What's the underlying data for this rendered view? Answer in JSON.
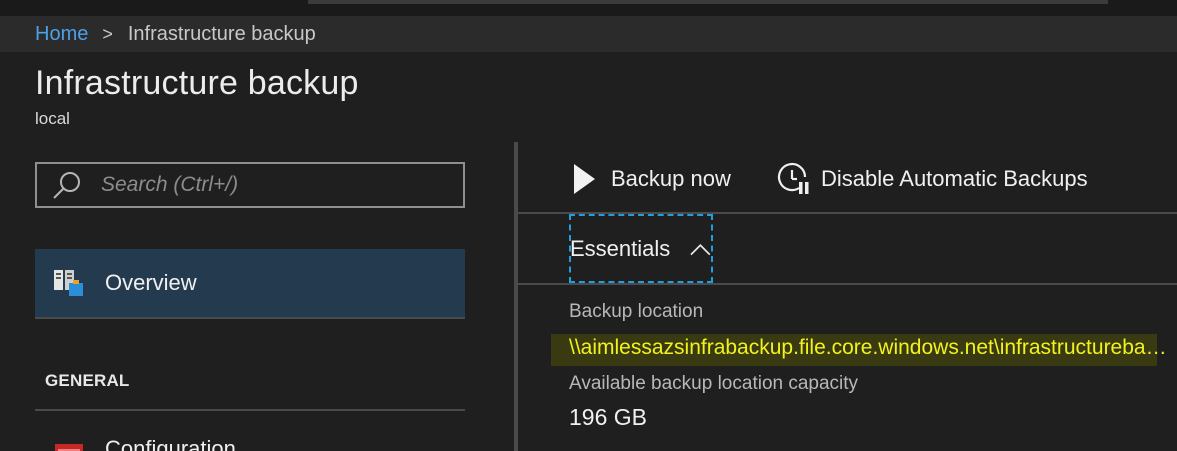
{
  "breadcrumb": {
    "home": "Home",
    "separator": ">",
    "current": "Infrastructure backup"
  },
  "page": {
    "title": "Infrastructure backup",
    "subtitle": "local"
  },
  "sidebar": {
    "search_placeholder": "Search (Ctrl+/)",
    "search_value": "",
    "overview": {
      "label": "Overview",
      "icon": "overview-servers-icon",
      "selected": true
    },
    "section_general": "GENERAL",
    "configuration": {
      "label": "Configuration",
      "icon": "configuration-icon"
    }
  },
  "toolbar": {
    "backup_now": {
      "label": "Backup now",
      "icon": "play-icon"
    },
    "disable_backups": {
      "label": "Disable Automatic Backups",
      "icon": "timer-pause-icon"
    }
  },
  "essentials": {
    "label": "Essentials",
    "expanded": true,
    "backup_location_label": "Backup location",
    "backup_location_value": "\\\\aimlessazsinfrabackup.file.core.windows.net\\infrastructurebackup",
    "capacity_label": "Available backup location capacity",
    "capacity_value": "196 GB"
  },
  "colors": {
    "accent_link": "#4ba0e8",
    "selected_nav": "#243a4f",
    "highlight_text": "#f2f21c",
    "focus_outline": "#1f9fe0"
  }
}
